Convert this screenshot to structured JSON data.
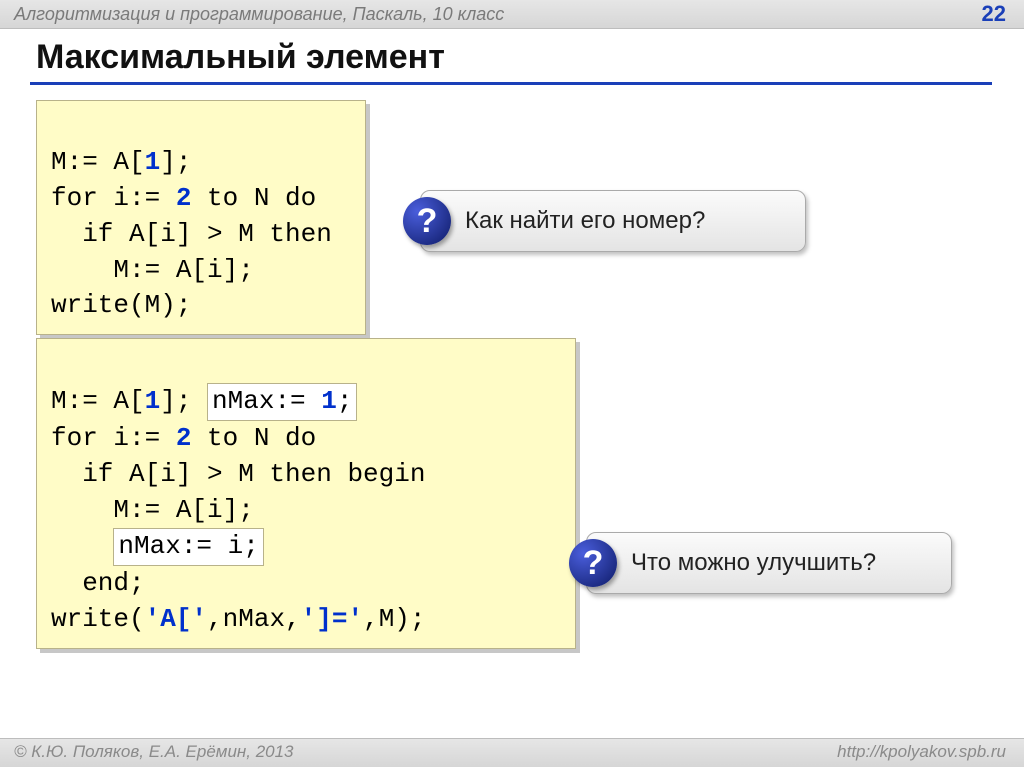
{
  "header": {
    "breadcrumb": "Алгоритмизация и программирование, Паскаль, 10 класс",
    "page_number": "22"
  },
  "title": "Максимальный элемент",
  "code1": {
    "l1a": "M:= A[",
    "l1idx": "1",
    "l1b": "];",
    "l2a": "for i:= ",
    "l2num": "2",
    "l2b": " to N do",
    "l3": "  if A[i] > M then",
    "l4": "    M:= A[i];",
    "l5": "write(M);"
  },
  "callout1": {
    "mark": "?",
    "text": "Как найти его номер?"
  },
  "code2": {
    "l1a": "M:= A[",
    "l1idx": "1",
    "l1b": "]; ",
    "hl1a": "nMax:= ",
    "hl1n": "1",
    "hl1b": ";",
    "l2a": "for i:= ",
    "l2num": "2",
    "l2b": " to N do",
    "l3": "  if A[i] > M then begin",
    "l4": "    M:= A[i];",
    "hl2": "nMax:= i;",
    "l6": "  end;",
    "l7a": "write(",
    "l7s1": "'A['",
    "l7b": ",nMax,",
    "l7s2": "']='",
    "l7c": ",M);"
  },
  "callout2": {
    "mark": "?",
    "text": "Что можно улучшить?"
  },
  "footer": {
    "left": "© К.Ю. Поляков, Е.А. Ерёмин, 2013",
    "right": "http://kpolyakov.spb.ru"
  }
}
